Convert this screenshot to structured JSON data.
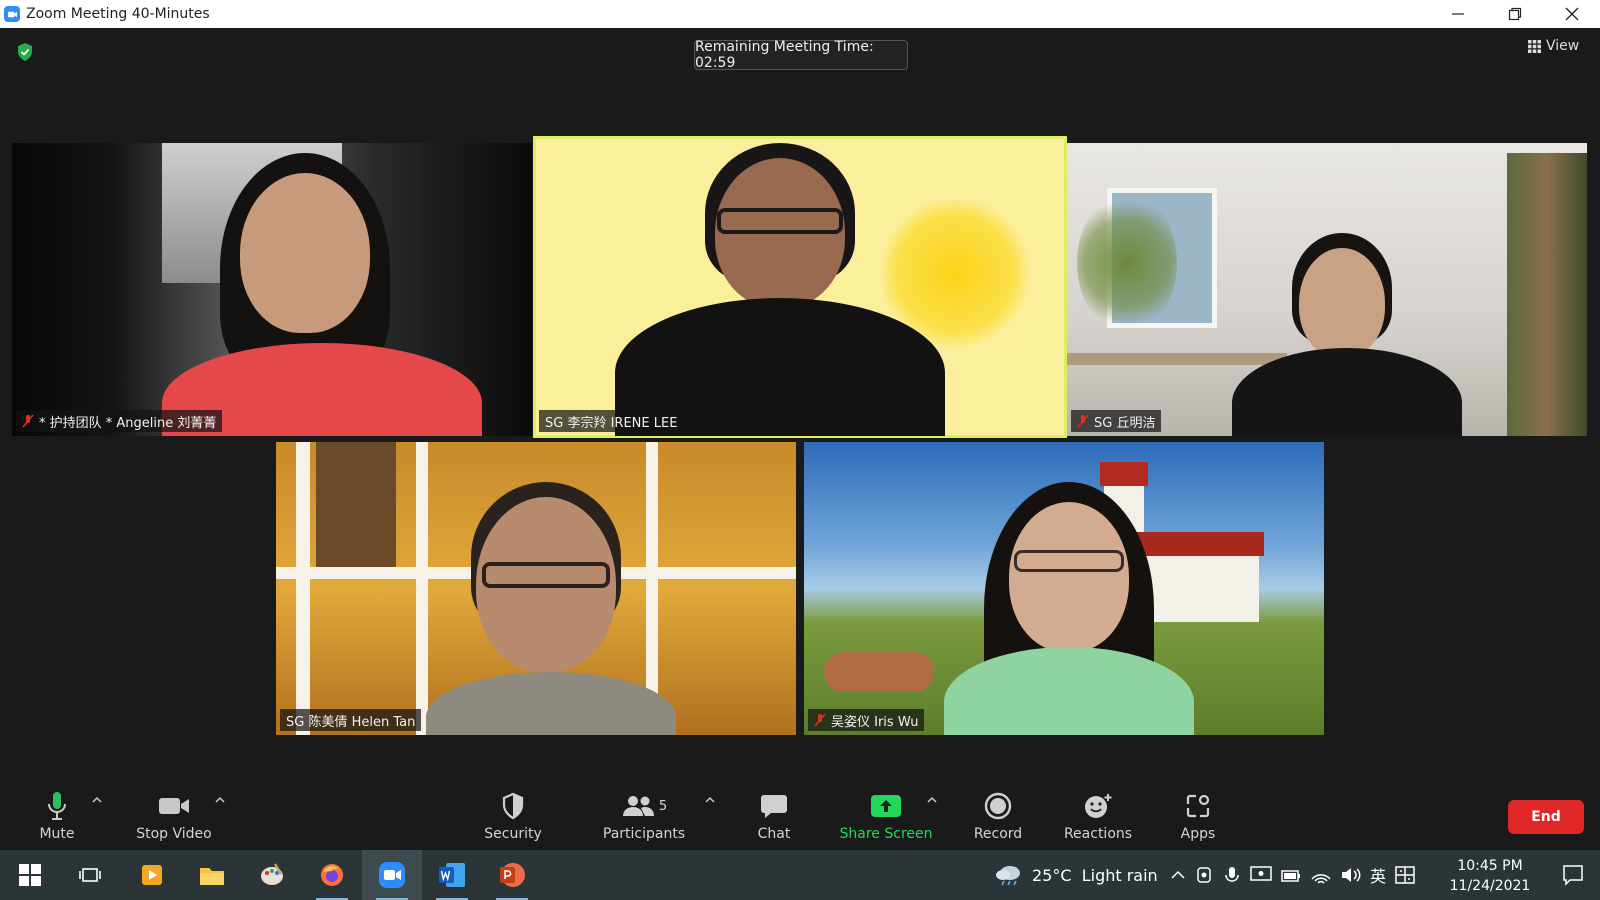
{
  "window": {
    "title": "Zoom Meeting 40-Minutes"
  },
  "meeting": {
    "remaining_time": "Remaining Meeting Time: 02:59",
    "view_label": "View",
    "participants": [
      {
        "name": "* 护持团队 * Angeline 刘菁菁",
        "muted": true
      },
      {
        "name": "SG 李宗羚 IRENE LEE",
        "muted": false,
        "active_speaker": true
      },
      {
        "name": "SG 丘明洁",
        "muted": true
      },
      {
        "name": "SG 陈美倩 Helen Tan",
        "muted": false
      },
      {
        "name": "吴姿仪 Iris Wu",
        "muted": true
      }
    ]
  },
  "toolbar": {
    "mute": "Mute",
    "stop_video": "Stop Video",
    "security": "Security",
    "participants": "Participants",
    "participants_count": "5",
    "chat": "Chat",
    "share_screen": "Share Screen",
    "record": "Record",
    "reactions": "Reactions",
    "apps": "Apps",
    "end": "End"
  },
  "taskbar": {
    "weather": "25°C  Light rain",
    "ime": "英",
    "time": "10:45 PM",
    "date": "11/24/2021"
  },
  "colors": {
    "active_speaker_border": "#d9f060",
    "share_green": "#23d959",
    "end_red": "#e02828",
    "zoom_blue": "#2d8cff"
  }
}
